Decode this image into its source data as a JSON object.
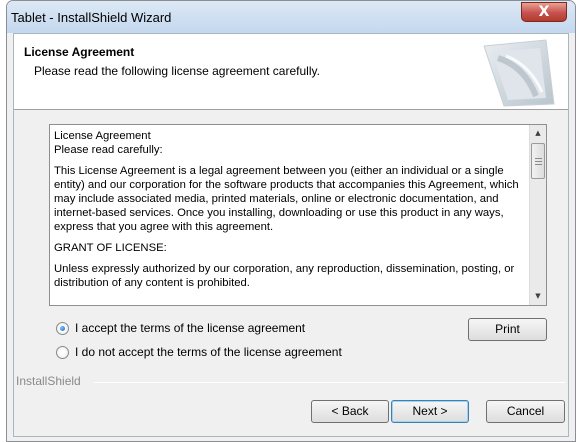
{
  "window": {
    "title": "Tablet - InstallShield Wizard",
    "close_glyph": "X"
  },
  "header": {
    "title": "License Agreement",
    "subtitle": "Please read the following license agreement carefully."
  },
  "license": {
    "line1": "License Agreement",
    "line2": "Please read carefully:",
    "para1": "This License Agreement is a legal agreement between you (either an individual or a single entity) and our corporation for the software products that accompanies this Agreement, which may include associated media, printed materials, online or electronic documentation, and internet-based services. Once you installing, downloading or use this product in any ways, express that you agree with this agreement.",
    "para2": "GRANT OF LICENSE:",
    "para3": "Unless expressly authorized by our corporation, any reproduction, dissemination, posting, or distribution of any content is prohibited.",
    "scroll_up_glyph": "▲",
    "scroll_down_glyph": "▼"
  },
  "options": {
    "accept_label": "I accept the terms of the license agreement",
    "decline_label": "I do not accept the terms of the license agreement",
    "selected": "accept"
  },
  "buttons": {
    "print": "Print",
    "back": "< Back",
    "next": "Next >",
    "cancel": "Cancel"
  },
  "footer": {
    "brand": "InstallShield"
  }
}
